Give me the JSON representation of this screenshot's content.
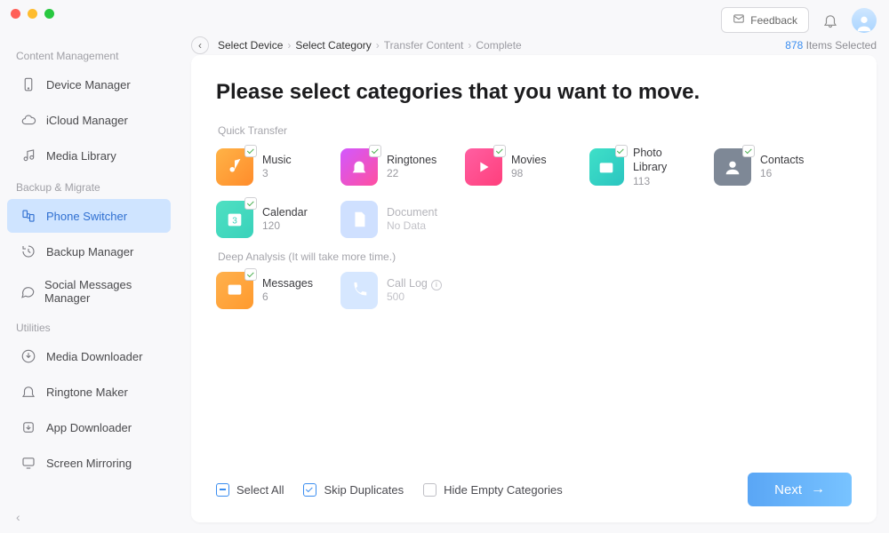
{
  "topbar": {
    "feedback_label": "Feedback"
  },
  "sidebar": {
    "sections": {
      "content_mgmt": {
        "title": "Content Management"
      },
      "backup_migrate": {
        "title": "Backup & Migrate"
      },
      "utilities": {
        "title": "Utilities"
      }
    },
    "items": [
      {
        "label": "Device Manager"
      },
      {
        "label": "iCloud Manager"
      },
      {
        "label": "Media Library"
      },
      {
        "label": "Phone Switcher"
      },
      {
        "label": "Backup Manager"
      },
      {
        "label": "Social Messages Manager"
      },
      {
        "label": "Media Downloader"
      },
      {
        "label": "Ringtone Maker"
      },
      {
        "label": "App Downloader"
      },
      {
        "label": "Screen Mirroring"
      }
    ]
  },
  "crumbs": {
    "c1": "Select Device",
    "c2": "Select Category",
    "c3": "Transfer Content",
    "c4": "Complete"
  },
  "selected": {
    "count": "878",
    "suffix": "Items Selected"
  },
  "headline": "Please select categories that you want to move.",
  "groups": {
    "quick": "Quick Transfer",
    "deep": "Deep Analysis (It will take more time.)"
  },
  "tiles": {
    "music": {
      "name": "Music",
      "count": "3"
    },
    "ring": {
      "name": "Ringtones",
      "count": "22"
    },
    "movies": {
      "name": "Movies",
      "count": "98"
    },
    "photo": {
      "name": "Photo Library",
      "count": "113"
    },
    "contacts": {
      "name": "Contacts",
      "count": "16"
    },
    "calendar": {
      "name": "Calendar",
      "count": "120"
    },
    "document": {
      "name": "Document",
      "count": "No Data"
    },
    "messages": {
      "name": "Messages",
      "count": "6"
    },
    "calllog": {
      "name": "Call Log",
      "count": "500"
    }
  },
  "footer": {
    "select_all": "Select All",
    "skip_dup": "Skip Duplicates",
    "hide_empty": "Hide Empty Categories",
    "next": "Next"
  }
}
